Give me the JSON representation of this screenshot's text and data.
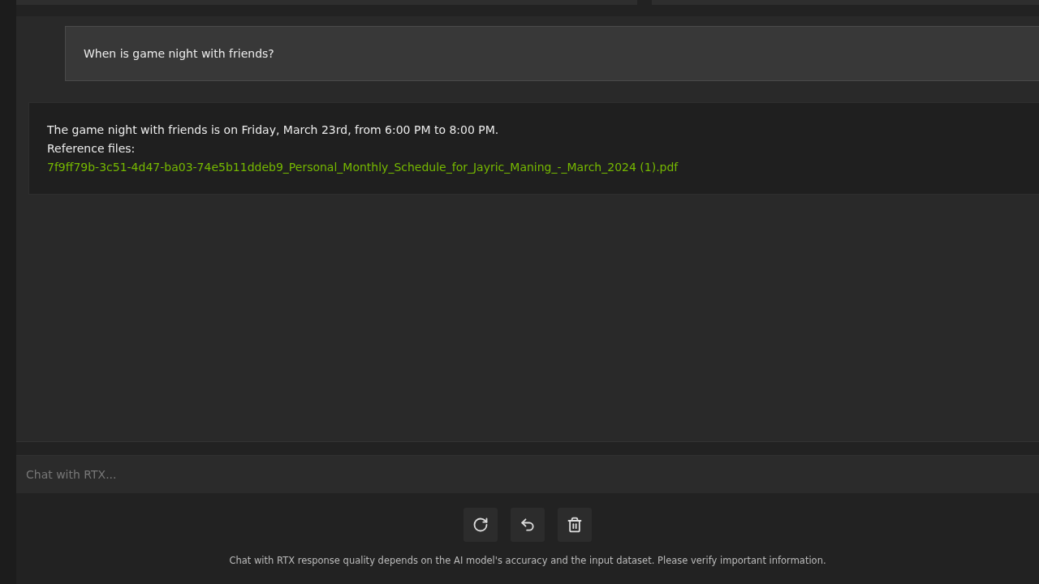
{
  "messages": [
    {
      "kind": "user",
      "text": "When is game night with friends?"
    },
    {
      "kind": "assistant",
      "text": "The game night with friends is on Friday, March 23rd, from 6:00 PM to 8:00 PM.",
      "reference_label": "Reference files:",
      "reference_link": "7f9ff79b-3c51-4d47-ba03-74e5b11ddeb9_Personal_Monthly_Schedule_for_Jayric_Maning_-_March_2024 (1).pdf"
    }
  ],
  "input": {
    "placeholder": "Chat with RTX..."
  },
  "actions": [
    {
      "kind": "regenerate"
    },
    {
      "kind": "undo"
    },
    {
      "kind": "delete"
    }
  ],
  "disclaimer": "Chat with RTX response quality depends on the AI model's accuracy and the input dataset. Please verify important information."
}
